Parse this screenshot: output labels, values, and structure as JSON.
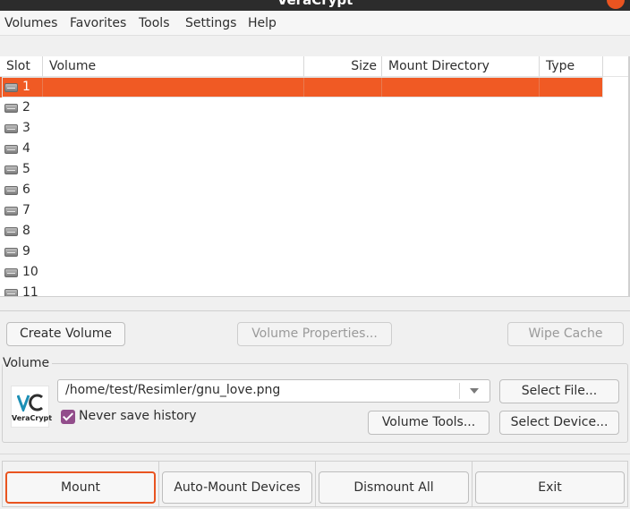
{
  "window": {
    "title": "VeraCrypt"
  },
  "menu": [
    "Volumes",
    "Favorites",
    "Tools",
    "Settings",
    "Help"
  ],
  "table": {
    "columns": [
      "Slot",
      "Volume",
      "Size",
      "Mount Directory",
      "Type"
    ],
    "slots": [
      "1",
      "2",
      "3",
      "4",
      "5",
      "6",
      "7",
      "8",
      "9",
      "10",
      "11"
    ],
    "selected_slot": "1"
  },
  "actions": {
    "create_volume": "Create Volume",
    "volume_properties": "Volume Properties...",
    "wipe_cache": "Wipe Cache"
  },
  "volume_group": {
    "label": "Volume",
    "path": "/home/test/Resimler/gnu_love.png",
    "never_save_history": {
      "label": "Never save history",
      "checked": true
    },
    "select_file": "Select File...",
    "volume_tools": "Volume Tools...",
    "select_device": "Select Device...",
    "logo_text": "VeraCrypt"
  },
  "bottom_buttons": {
    "mount": "Mount",
    "auto_mount": "Auto-Mount Devices",
    "dismount_all": "Dismount All",
    "exit": "Exit"
  },
  "colors": {
    "accent": "#e95420",
    "selection": "#f05a24",
    "checkbox": "#924d8b"
  }
}
